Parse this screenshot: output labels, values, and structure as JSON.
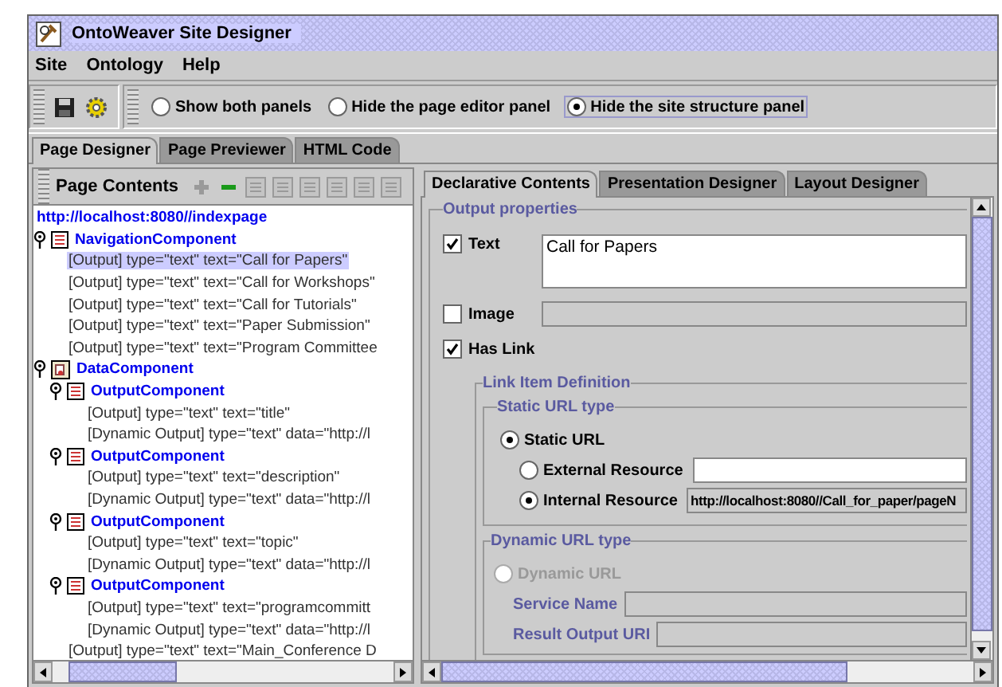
{
  "window": {
    "title": "OntoWeaver Site Designer"
  },
  "menu": [
    "Site",
    "Ontology",
    "Help"
  ],
  "panel_options": [
    {
      "label": "Show both panels",
      "selected": false
    },
    {
      "label": "Hide the page editor panel",
      "selected": false
    },
    {
      "label": "Hide the site structure panel",
      "selected": true
    }
  ],
  "main_tabs": [
    {
      "label": "Page Designer",
      "selected": true
    },
    {
      "label": "Page Previewer",
      "selected": false
    },
    {
      "label": "HTML Code",
      "selected": false
    }
  ],
  "page_contents": {
    "title": "Page Contents",
    "tree": [
      {
        "kind": "page",
        "label": "http://localhost:8080//indexpage",
        "children": [
          {
            "kind": "navigation",
            "label": "NavigationComponent",
            "expanded": true,
            "children": [
              {
                "kind": "output",
                "label": "[Output] type=\"text\"  text=\"Call for Papers\"",
                "selected": true
              },
              {
                "kind": "output",
                "label": "[Output] type=\"text\"  text=\"Call for Workshops\"",
                "selected": false
              },
              {
                "kind": "output",
                "label": "[Output] type=\"text\"  text=\"Call for Tutorials\"",
                "selected": false
              },
              {
                "kind": "output",
                "label": "[Output] type=\"text\"  text=\"Paper Submission\"",
                "selected": false
              },
              {
                "kind": "output",
                "label": "[Output] type=\"text\"  text=\"Program Committee",
                "selected": false
              }
            ]
          },
          {
            "kind": "data",
            "label": "DataComponent",
            "expanded": true,
            "children": [
              {
                "kind": "navigation",
                "label": "OutputComponent",
                "expanded": true,
                "children": [
                  {
                    "kind": "output",
                    "label": "[Output] type=\"text\"  text=\"title\"",
                    "selected": false
                  },
                  {
                    "kind": "output",
                    "label": "[Dynamic Output]  type=\"text\" data=\"http://l",
                    "selected": false
                  }
                ]
              },
              {
                "kind": "navigation",
                "label": "OutputComponent",
                "expanded": true,
                "children": [
                  {
                    "kind": "output",
                    "label": "[Output] type=\"text\"  text=\"description\"",
                    "selected": false
                  },
                  {
                    "kind": "output",
                    "label": "[Dynamic Output]  type=\"text\" data=\"http://l",
                    "selected": false
                  }
                ]
              },
              {
                "kind": "navigation",
                "label": "OutputComponent",
                "expanded": true,
                "children": [
                  {
                    "kind": "output",
                    "label": "[Output] type=\"text\"  text=\"topic\"",
                    "selected": false
                  },
                  {
                    "kind": "output",
                    "label": "[Dynamic Output]  type=\"text\" data=\"http://l",
                    "selected": false
                  }
                ]
              },
              {
                "kind": "navigation",
                "label": "OutputComponent",
                "expanded": true,
                "children": [
                  {
                    "kind": "output",
                    "label": "[Output] type=\"text\"  text=\"programcommitt",
                    "selected": false
                  },
                  {
                    "kind": "output",
                    "label": "[Dynamic Output]  type=\"text\" data=\"http://l",
                    "selected": false
                  }
                ]
              },
              {
                "kind": "output",
                "label": "[Output] type=\"text\"  text=\"Main_Conference D",
                "selected": false
              }
            ]
          }
        ]
      }
    ]
  },
  "editor_tabs": [
    {
      "label": "Declarative Contents",
      "selected": true
    },
    {
      "label": "Presentation Designer",
      "selected": false
    },
    {
      "label": "Layout Designer",
      "selected": false
    }
  ],
  "output_properties": {
    "title": "Output properties",
    "text": {
      "label": "Text",
      "checked": true,
      "value": "Call for Papers"
    },
    "image": {
      "label": "Image",
      "checked": false
    },
    "has_link": {
      "label": "Has Link",
      "checked": true
    }
  },
  "link_item": {
    "title": "Link Item Definition",
    "static": {
      "title": "Static URL type",
      "static_url": {
        "label": "Static URL",
        "selected": true
      },
      "external": {
        "label": "External Resource",
        "selected": false
      },
      "internal": {
        "label": "Internal Resource",
        "selected": true,
        "value": "http://localhost:8080//Call_for_paper/pageN"
      }
    },
    "dynamic": {
      "title": "Dynamic URL type",
      "dynamic_url": {
        "label": "Dynamic URL",
        "selected": false,
        "disabled": true
      },
      "service_name": {
        "label": "Service Name"
      },
      "result_output": {
        "label": "Result Output URI"
      }
    }
  }
}
